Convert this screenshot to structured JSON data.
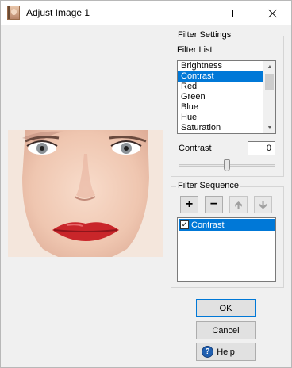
{
  "window": {
    "title": "Adjust Image 1"
  },
  "filter_settings": {
    "title": "Filter Settings",
    "list_label": "Filter List",
    "items": [
      "Brightness",
      "Contrast",
      "Red",
      "Green",
      "Blue",
      "Hue",
      "Saturation"
    ],
    "selected": "Contrast",
    "value_label": "Contrast",
    "value": "0",
    "slider_level_fraction": 0.5
  },
  "filter_sequence": {
    "title": "Filter Sequence",
    "items": [
      {
        "label": "Contrast",
        "checked": true
      }
    ]
  },
  "buttons": {
    "ok": "OK",
    "cancel": "Cancel",
    "help": "Help"
  },
  "colors": {
    "selection": "#0078d7",
    "help_icon": "#1f5fb0"
  }
}
